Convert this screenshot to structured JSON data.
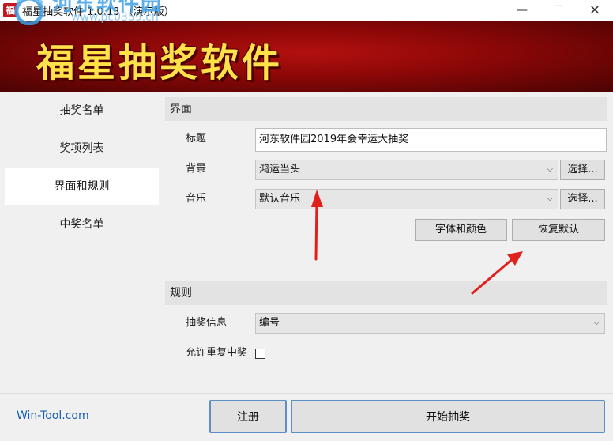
{
  "window": {
    "title": "福星抽奖软件 1.0.13 （演示版）",
    "app_icon_glyph": "福",
    "minimize_glyph": "—",
    "maximize_glyph": "☐",
    "close_glyph": "✕"
  },
  "banner": {
    "title": "福星抽奖软件",
    "watermark_text": "河东软件园",
    "watermark_url": "www.pc0359.cn"
  },
  "sidebar": {
    "items": [
      {
        "label": "抽奖名单",
        "active": false
      },
      {
        "label": "奖项列表",
        "active": false
      },
      {
        "label": "界面和规则",
        "active": true
      },
      {
        "label": "中奖名单",
        "active": false
      }
    ]
  },
  "ui_section": {
    "header": "界面",
    "title_label": "标题",
    "title_value": "河东软件园2019年会幸运大抽奖",
    "background_label": "背景",
    "background_value": "鸿运当头",
    "music_label": "音乐",
    "music_value": "默认音乐",
    "choose_label": "选择...",
    "font_color_button": "字体和颜色",
    "restore_default_button": "恢复默认"
  },
  "rules_section": {
    "header": "规则",
    "info_label": "抽奖信息",
    "info_value": "编号",
    "allow_repeat_label": "允许重复中奖",
    "allow_repeat_checked": false
  },
  "footer": {
    "link": "Win-Tool.com",
    "register_button": "注册",
    "start_button": "开始抽奖"
  },
  "colors": {
    "banner_red": "#8a0707",
    "banner_text": "#ffe14a",
    "link_blue": "#1a5fb4",
    "annotation_arrow": "#e0201b"
  }
}
